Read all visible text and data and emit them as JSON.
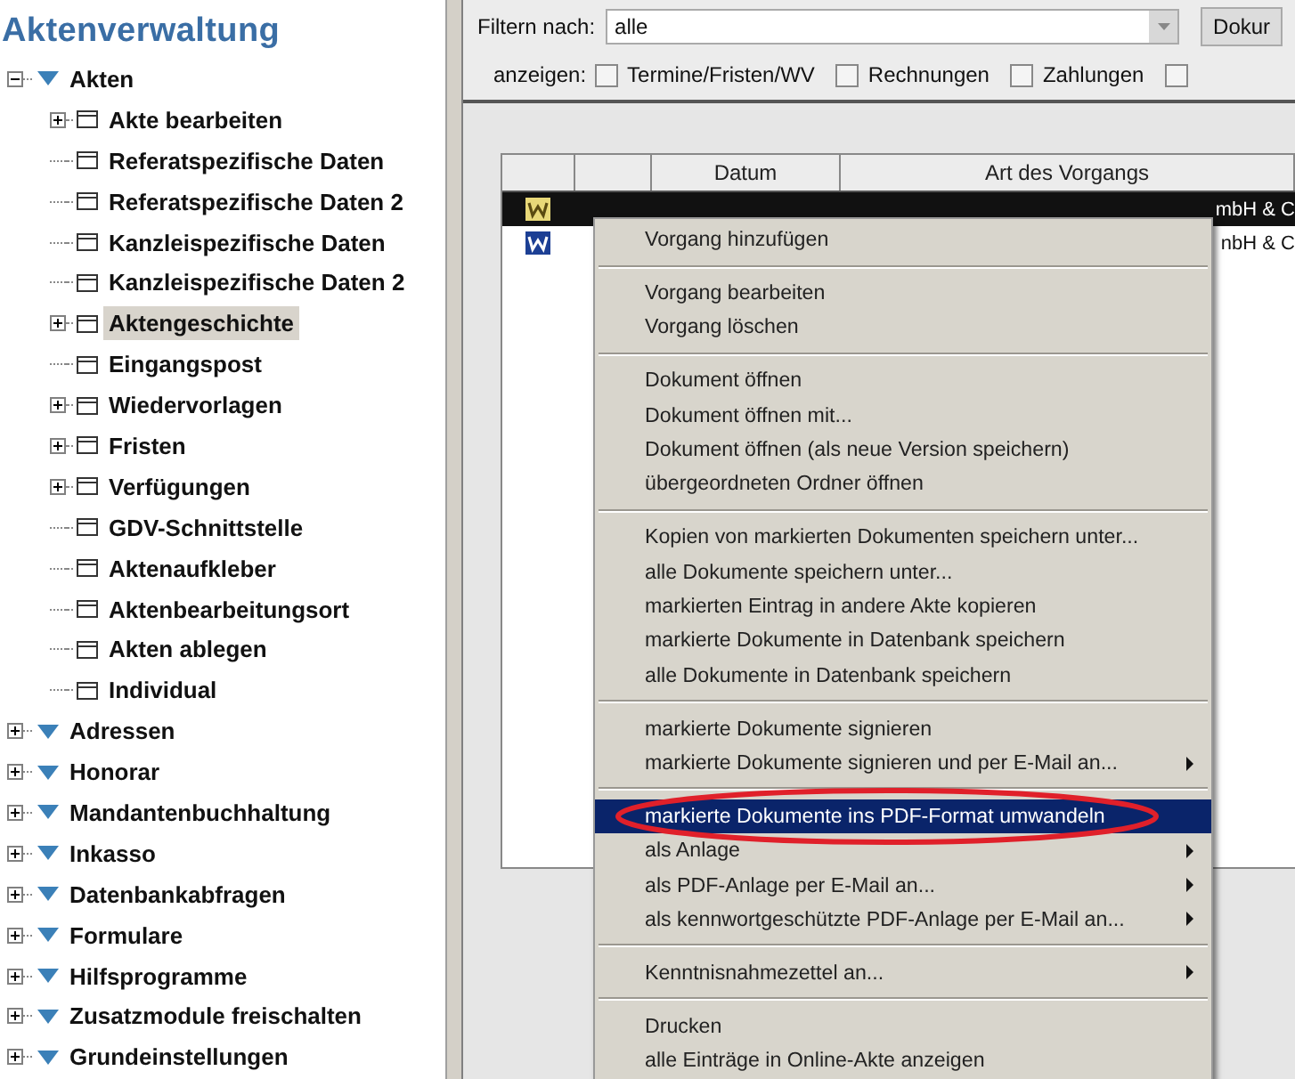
{
  "sidebar": {
    "title": "Aktenverwaltung",
    "items": [
      {
        "label": "Akten",
        "expanded": true,
        "children": [
          {
            "label": "Akte bearbeiten",
            "expandable": true,
            "selected": false
          },
          {
            "label": "Referatspezifische Daten",
            "expandable": false,
            "selected": false
          },
          {
            "label": "Referatspezifische Daten 2",
            "expandable": false,
            "selected": false
          },
          {
            "label": "Kanzleispezifische Daten",
            "expandable": false,
            "selected": false
          },
          {
            "label": "Kanzleispezifische Daten 2",
            "expandable": false,
            "selected": false
          },
          {
            "label": "Aktengeschichte",
            "expandable": true,
            "selected": true
          },
          {
            "label": "Eingangspost",
            "expandable": false,
            "selected": false
          },
          {
            "label": "Wiedervorlagen",
            "expandable": true,
            "selected": false
          },
          {
            "label": "Fristen",
            "expandable": true,
            "selected": false
          },
          {
            "label": "Verfügungen",
            "expandable": true,
            "selected": false
          },
          {
            "label": "GDV-Schnittstelle",
            "expandable": false,
            "selected": false
          },
          {
            "label": "Aktenaufkleber",
            "expandable": false,
            "selected": false
          },
          {
            "label": "Aktenbearbeitungsort",
            "expandable": false,
            "selected": false
          },
          {
            "label": "Akten ablegen",
            "expandable": false,
            "selected": false
          },
          {
            "label": "Individual",
            "expandable": false,
            "selected": false
          }
        ]
      },
      {
        "label": "Adressen",
        "expanded": false
      },
      {
        "label": "Honorar",
        "expanded": false
      },
      {
        "label": "Mandantenbuchhaltung",
        "expanded": false
      },
      {
        "label": "Inkasso",
        "expanded": false
      },
      {
        "label": "Datenbankabfragen",
        "expanded": false
      },
      {
        "label": "Formulare",
        "expanded": false
      },
      {
        "label": "Hilfsprogramme",
        "expanded": false
      },
      {
        "label": "Zusatzmodule freischalten",
        "expanded": false
      },
      {
        "label": "Grundeinstellungen",
        "expanded": false
      }
    ]
  },
  "filter": {
    "label": "Filtern nach:",
    "value": "alle",
    "button": "Dokur"
  },
  "show": {
    "label": "anzeigen:",
    "options": [
      {
        "label": "Termine/Fristen/WV",
        "checked": false
      },
      {
        "label": "Rechnungen",
        "checked": false
      },
      {
        "label": "Zahlungen",
        "checked": false
      },
      {
        "checked": false
      }
    ]
  },
  "table": {
    "columns": [
      "Datum",
      "Art des Vorgangs"
    ],
    "rows": [
      {
        "selected": true,
        "art": "mbH & C"
      },
      {
        "selected": false,
        "art": "nbH & C"
      }
    ]
  },
  "context_menu": {
    "groups": [
      [
        {
          "label": "Vorgang hinzufügen",
          "submenu": false,
          "selected": false
        }
      ],
      [
        {
          "label": "Vorgang bearbeiten",
          "submenu": false,
          "selected": false
        },
        {
          "label": "Vorgang löschen",
          "submenu": false,
          "selected": false
        }
      ],
      [
        {
          "label": "Dokument öffnen",
          "submenu": false,
          "selected": false
        },
        {
          "label": "Dokument öffnen mit...",
          "submenu": false,
          "selected": false
        },
        {
          "label": "Dokument öffnen (als neue Version speichern)",
          "submenu": false,
          "selected": false
        },
        {
          "label": "übergeordneten Ordner öffnen",
          "submenu": false,
          "selected": false
        }
      ],
      [
        {
          "label": "Kopien von markierten Dokumenten speichern unter...",
          "submenu": false,
          "selected": false
        },
        {
          "label": "alle Dokumente speichern unter...",
          "submenu": false,
          "selected": false
        },
        {
          "label": "markierten Eintrag in andere Akte kopieren",
          "submenu": false,
          "selected": false
        },
        {
          "label": "markierte Dokumente in Datenbank speichern",
          "submenu": false,
          "selected": false
        },
        {
          "label": "alle Dokumente in Datenbank speichern",
          "submenu": false,
          "selected": false
        }
      ],
      [
        {
          "label": "markierte Dokumente signieren",
          "submenu": false,
          "selected": false
        },
        {
          "label": "markierte Dokumente signieren und per E-Mail an...",
          "submenu": true,
          "selected": false
        }
      ],
      [
        {
          "label": "markierte Dokumente ins PDF-Format umwandeln",
          "submenu": false,
          "selected": true
        },
        {
          "label": "als Anlage",
          "submenu": true,
          "selected": false
        },
        {
          "label": "als PDF-Anlage per E-Mail an...",
          "submenu": true,
          "selected": false
        },
        {
          "label": "als kennwortgeschützte PDF-Anlage per E-Mail an...",
          "submenu": true,
          "selected": false
        }
      ],
      [
        {
          "label": "Kenntnisnahmezettel an...",
          "submenu": true,
          "selected": false
        }
      ],
      [
        {
          "label": "Drucken",
          "submenu": false,
          "selected": false
        },
        {
          "label": "alle Einträge in Online-Akte anzeigen",
          "submenu": false,
          "selected": false
        }
      ]
    ]
  }
}
